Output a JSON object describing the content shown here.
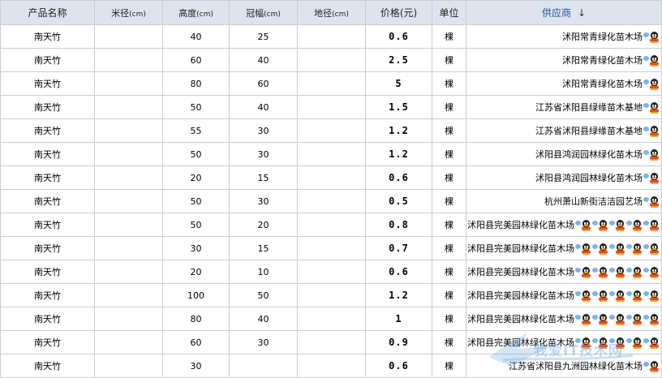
{
  "table": {
    "headers": {
      "name": "产品名称",
      "mijing": "米径",
      "mijing_unit": "(cm)",
      "height": "高度",
      "height_unit": "(cm)",
      "crown": "冠幅",
      "crown_unit": "(cm)",
      "dijing": "地径",
      "dijing_unit": "(cm)",
      "price": "价格(元)",
      "unit": "单位",
      "supplier": "供应商",
      "sort_icon": "↓"
    },
    "rows": [
      {
        "name": "南天竹",
        "mijing": "",
        "height": "40",
        "crown": "25",
        "dijing": "",
        "price": "0.6",
        "unit": "棵",
        "supplier": "沭阳常青绿化苗木场",
        "qq_count": 1
      },
      {
        "name": "南天竹",
        "mijing": "",
        "height": "60",
        "crown": "40",
        "dijing": "",
        "price": "2.5",
        "unit": "棵",
        "supplier": "沭阳常青绿化苗木场",
        "qq_count": 1
      },
      {
        "name": "南天竹",
        "mijing": "",
        "height": "80",
        "crown": "60",
        "dijing": "",
        "price": "5",
        "unit": "棵",
        "supplier": "沭阳常青绿化苗木场",
        "qq_count": 1
      },
      {
        "name": "南天竹",
        "mijing": "",
        "height": "50",
        "crown": "40",
        "dijing": "",
        "price": "1.5",
        "unit": "棵",
        "supplier": "江苏省沭阳县绿缘苗木基地",
        "qq_count": 1
      },
      {
        "name": "南天竹",
        "mijing": "",
        "height": "55",
        "crown": "30",
        "dijing": "",
        "price": "1.2",
        "unit": "棵",
        "supplier": "江苏省沭阳县绿缘苗木基地",
        "qq_count": 1
      },
      {
        "name": "南天竹",
        "mijing": "",
        "height": "50",
        "crown": "30",
        "dijing": "",
        "price": "1.2",
        "unit": "棵",
        "supplier": "沭阳县鸿润园林绿化苗木场",
        "qq_count": 1
      },
      {
        "name": "南天竹",
        "mijing": "",
        "height": "20",
        "crown": "15",
        "dijing": "",
        "price": "0.6",
        "unit": "棵",
        "supplier": "沭阳县鸿润园林绿化苗木场",
        "qq_count": 1
      },
      {
        "name": "南天竹",
        "mijing": "",
        "height": "50",
        "crown": "30",
        "dijing": "",
        "price": "0.5",
        "unit": "棵",
        "supplier": "杭州萧山新街洁洁园艺场",
        "qq_count": 1
      },
      {
        "name": "南天竹",
        "mijing": "",
        "height": "50",
        "crown": "20",
        "dijing": "",
        "price": "0.8",
        "unit": "棵",
        "supplier": "沭阳县完美园林绿化苗木场",
        "qq_count": 5
      },
      {
        "name": "南天竹",
        "mijing": "",
        "height": "30",
        "crown": "15",
        "dijing": "",
        "price": "0.7",
        "unit": "棵",
        "supplier": "沭阳县完美园林绿化苗木场",
        "qq_count": 5
      },
      {
        "name": "南天竹",
        "mijing": "",
        "height": "20",
        "crown": "10",
        "dijing": "",
        "price": "0.6",
        "unit": "棵",
        "supplier": "沭阳县完美园林绿化苗木场",
        "qq_count": 5
      },
      {
        "name": "南天竹",
        "mijing": "",
        "height": "100",
        "crown": "50",
        "dijing": "",
        "price": "1.2",
        "unit": "棵",
        "supplier": "沭阳县完美园林绿化苗木场",
        "qq_count": 5
      },
      {
        "name": "南天竹",
        "mijing": "",
        "height": "80",
        "crown": "40",
        "dijing": "",
        "price": "1",
        "unit": "棵",
        "supplier": "沭阳县完美园林绿化苗木场",
        "qq_count": 5
      },
      {
        "name": "南天竹",
        "mijing": "",
        "height": "60",
        "crown": "30",
        "dijing": "",
        "price": "0.9",
        "unit": "棵",
        "supplier": "沭阳县完美园林绿化苗木场",
        "qq_count": 5
      },
      {
        "name": "南天竹",
        "mijing": "",
        "height": "30",
        "crown": "",
        "dijing": "",
        "price": "0.6",
        "unit": "棵",
        "supplier": "江苏省沭阳县九洲园林绿化苗木场",
        "qq_count": 1
      }
    ]
  },
  "watermark": {
    "text": "我爱IT技术网"
  },
  "colors": {
    "header_bg": "#dde4ee",
    "border": "#c6cdd6",
    "supplier_header": "#1f4fa3",
    "qq_body": "#e34a2b",
    "bubble": "#7bb4e6"
  },
  "icons": {
    "contact": "qq-penguin-icon",
    "status": "chat-bubble-icon"
  }
}
